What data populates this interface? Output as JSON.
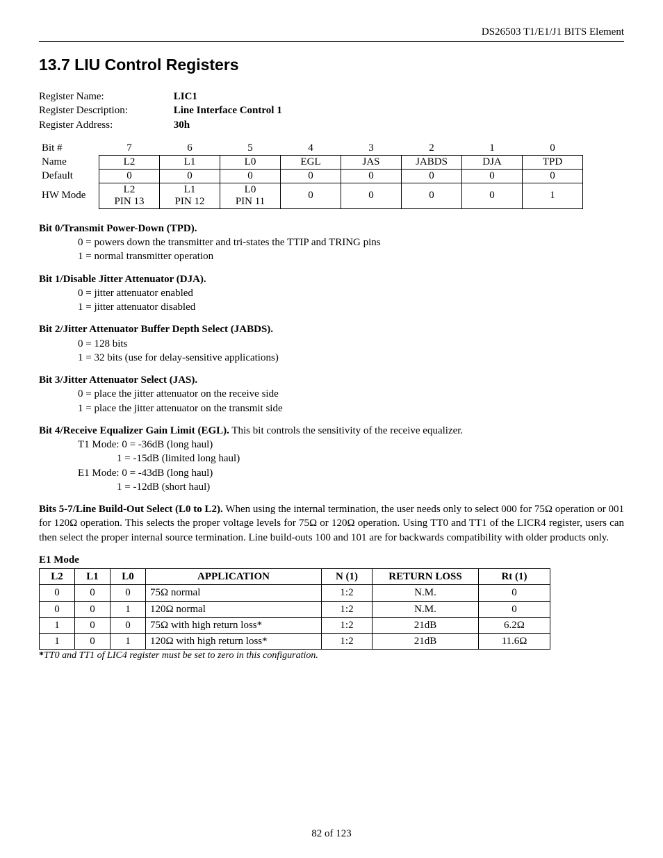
{
  "header": {
    "doc_title": "DS26503 T1/E1/J1 BITS Element"
  },
  "section": {
    "heading": "13.7  LIU Control Registers"
  },
  "reg": {
    "name_label": "Register Name:",
    "name": "LIC1",
    "desc_label": "Register Description:",
    "desc": "Line Interface Control 1",
    "addr_label": "Register Address:",
    "addr": "30h"
  },
  "bits_table": {
    "row_labels": {
      "bit": "Bit #",
      "name": "Name",
      "default": "Default",
      "hw": "HW Mode"
    },
    "cols": [
      {
        "bit": "7",
        "name": "L2",
        "def": "0",
        "hw": "L2\nPIN 13"
      },
      {
        "bit": "6",
        "name": "L1",
        "def": "0",
        "hw": "L1\nPIN 12"
      },
      {
        "bit": "5",
        "name": "L0",
        "def": "0",
        "hw": "L0\nPIN 11"
      },
      {
        "bit": "4",
        "name": "EGL",
        "def": "0",
        "hw": "0"
      },
      {
        "bit": "3",
        "name": "JAS",
        "def": "0",
        "hw": "0"
      },
      {
        "bit": "2",
        "name": "JABDS",
        "def": "0",
        "hw": "0"
      },
      {
        "bit": "1",
        "name": "DJA",
        "def": "0",
        "hw": "0"
      },
      {
        "bit": "0",
        "name": "TPD",
        "def": "0",
        "hw": "1"
      }
    ]
  },
  "descriptions": {
    "bit0_title": "Bit 0/Transmit Power-Down (TPD).",
    "bit0_l0": "0 = powers down the transmitter and tri-states the TTIP and TRING pins",
    "bit0_l1": "1 = normal transmitter operation",
    "bit1_title": "Bit 1/Disable Jitter Attenuator (DJA).",
    "bit1_l0": "0 = jitter attenuator enabled",
    "bit1_l1": "1 = jitter attenuator disabled",
    "bit2_title": "Bit 2/Jitter Attenuator Buffer Depth Select (JABDS).",
    "bit2_l0": "0 = 128 bits",
    "bit2_l1": "1 = 32 bits (use for delay-sensitive applications)",
    "bit3_title": "Bit 3/Jitter Attenuator Select (JAS).",
    "bit3_l0": "0 = place the jitter attenuator on the receive side",
    "bit3_l1": "1 = place the jitter attenuator on the transmit side",
    "bit4_title": "Bit 4/Receive Equalizer Gain Limit (EGL).",
    "bit4_tail": " This bit controls the sensitivity of the receive equalizer.",
    "bit4_t1a": "T1 Mode: 0 = -36dB (long haul)",
    "bit4_t1b": "1 = -15dB (limited long haul)",
    "bit4_e1a": "E1 Mode: 0 = -43dB (long haul)",
    "bit4_e1b": "1 = -12dB (short haul)",
    "bit57_title": "Bits 5-7/Line Build-Out Select (L0 to L2).",
    "bit57_body": " When using the internal termination, the user needs only to select 000 for 75Ω operation or 001 for 120Ω operation. This selects the proper voltage levels for 75Ω or 120Ω operation. Using TT0 and TT1 of the LICR4 register, users can then select the proper internal source termination. Line build-outs 100 and 101 are for backwards compatibility with older products only."
  },
  "e1": {
    "title": "E1 Mode",
    "headers": {
      "l2": "L2",
      "l1": "L1",
      "l0": "L0",
      "app": "APPLICATION",
      "n": "N (1)",
      "rl": "RETURN LOSS",
      "rt": "Rt (1)"
    },
    "rows": [
      {
        "l2": "0",
        "l1": "0",
        "l0": "0",
        "app": "75Ω normal",
        "n": "1:2",
        "rl": "N.M.",
        "rt": "0"
      },
      {
        "l2": "0",
        "l1": "0",
        "l0": "1",
        "app": "120Ω normal",
        "n": "1:2",
        "rl": "N.M.",
        "rt": "0"
      },
      {
        "l2": "1",
        "l1": "0",
        "l0": "0",
        "app": "75Ω with high return loss*",
        "n": "1:2",
        "rl": "21dB",
        "rt": "6.2Ω"
      },
      {
        "l2": "1",
        "l1": "0",
        "l0": "1",
        "app": "120Ω with high return loss*",
        "n": "1:2",
        "rl": "21dB",
        "rt": "11.6Ω"
      }
    ],
    "footnote_star": "*",
    "footnote": "TT0 and TT1 of LIC4 register must be set to zero in this configuration."
  },
  "footer": {
    "page": "82 of 123"
  }
}
